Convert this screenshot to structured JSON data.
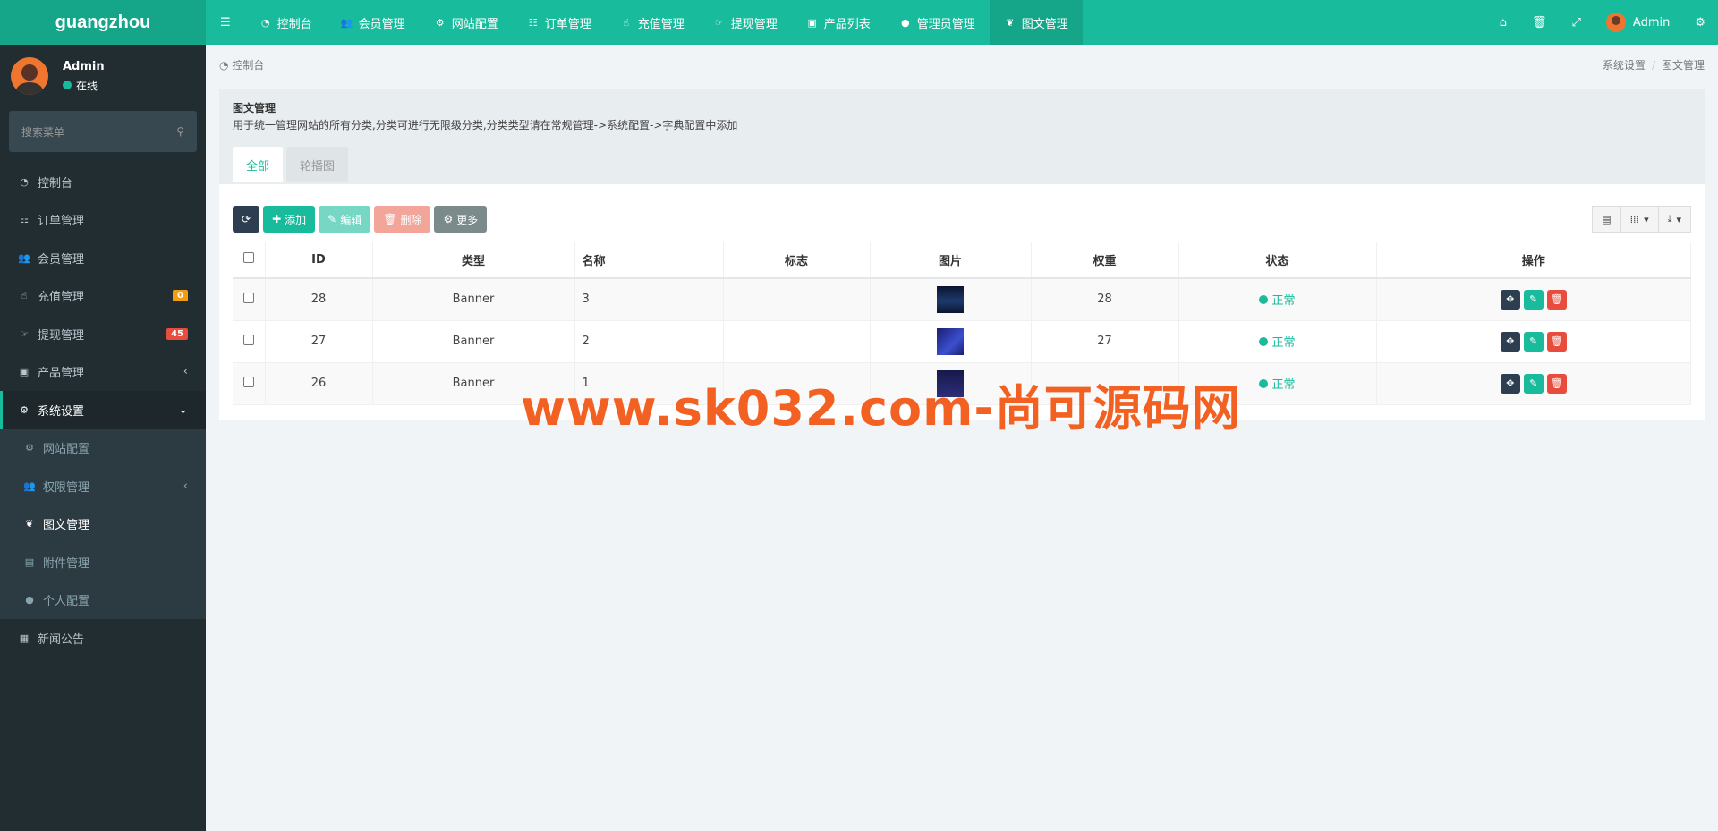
{
  "app": {
    "logo": "guangzhou"
  },
  "topnav": {
    "menu_icon": "bars-icon",
    "items": [
      {
        "label": "控制台",
        "icon": "dashboard-icon"
      },
      {
        "label": "会员管理",
        "icon": "users-icon"
      },
      {
        "label": "网站配置",
        "icon": "cog-icon"
      },
      {
        "label": "订单管理",
        "icon": "list-icon"
      },
      {
        "label": "充值管理",
        "icon": "hand-icon"
      },
      {
        "label": "提现管理",
        "icon": "hand-icon"
      },
      {
        "label": "产品列表",
        "icon": "shopping-bag-icon"
      },
      {
        "label": "管理员管理",
        "icon": "user-icon"
      },
      {
        "label": "图文管理",
        "icon": "leaf-icon"
      }
    ],
    "right": {
      "user_name": "Admin"
    }
  },
  "sidebar": {
    "user": {
      "name": "Admin",
      "status": "在线"
    },
    "search_placeholder": "搜索菜单",
    "items": [
      {
        "label": "控制台"
      },
      {
        "label": "订单管理"
      },
      {
        "label": "会员管理"
      },
      {
        "label": "充值管理",
        "badge": "0"
      },
      {
        "label": "提现管理",
        "badge": "45"
      },
      {
        "label": "产品管理"
      },
      {
        "label": "系统设置"
      }
    ],
    "submenu": [
      {
        "label": "网站配置"
      },
      {
        "label": "权限管理"
      },
      {
        "label": "图文管理"
      },
      {
        "label": "附件管理"
      },
      {
        "label": "个人配置"
      }
    ],
    "last_item": {
      "label": "新闻公告"
    }
  },
  "breadcrumb": {
    "home": "控制台",
    "trail": [
      "系统设置",
      "图文管理"
    ]
  },
  "panel": {
    "title": "图文管理",
    "description": "用于统一管理网站的所有分类,分类可进行无限级分类,分类类型请在常规管理->系统配置->字典配置中添加",
    "tabs": [
      "全部",
      "轮播图"
    ]
  },
  "toolbar": {
    "add": "添加",
    "edit": "编辑",
    "delete": "删除",
    "more": "更多"
  },
  "table": {
    "headers": [
      "ID",
      "类型",
      "名称",
      "标志",
      "图片",
      "权重",
      "状态",
      "操作"
    ],
    "rows": [
      {
        "id": "28",
        "type": "Banner",
        "name": "3",
        "flag": "",
        "weight": "28",
        "status": "正常",
        "image_color": "#0d1b3e"
      },
      {
        "id": "27",
        "type": "Banner",
        "name": "2",
        "flag": "",
        "weight": "27",
        "status": "正常",
        "image_color": "#2a2a9a"
      },
      {
        "id": "26",
        "type": "Banner",
        "name": "1",
        "flag": "",
        "weight": "",
        "status": "正常",
        "image_color": "#1a1a4a"
      }
    ]
  },
  "colors": {
    "accent": "#18bc9c",
    "sidebar": "#222d32",
    "danger": "#e74c3c",
    "warning": "#f39c12",
    "dark": "#2c3e50"
  },
  "watermark": "www.sk032.com-尚可源码网"
}
